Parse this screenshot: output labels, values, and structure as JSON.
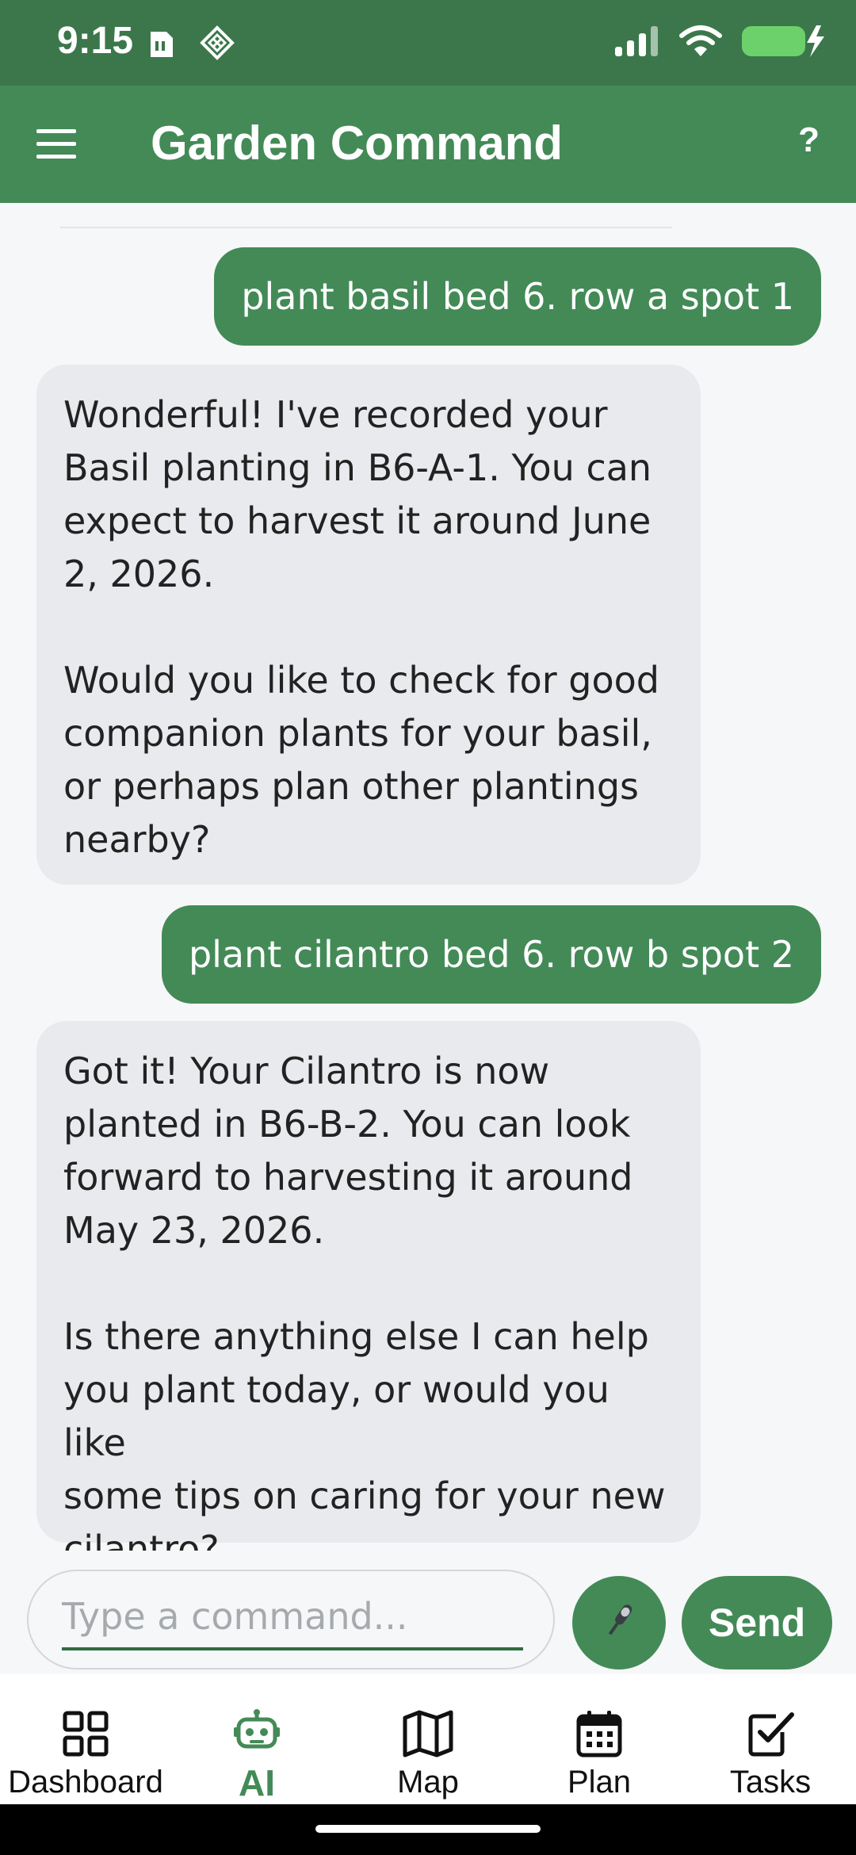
{
  "status_bar": {
    "time": "9:15",
    "left_icons": [
      "sim-card-icon",
      "diamond-icon"
    ],
    "right_icons": [
      "signal-icon",
      "wifi-icon",
      "battery-charging-icon"
    ],
    "battery_level": 0.95
  },
  "app_bar": {
    "menu_icon": "hamburger-menu-icon",
    "title": "Garden Command",
    "help_label": "?"
  },
  "chat": {
    "messages": [
      {
        "role": "user",
        "text": "plant basil bed 6. row a spot 1"
      },
      {
        "role": "assistant",
        "text": "Wonderful! I've recorded your\nBasil planting in B6-A-1. You can\nexpect to harvest it around June\n2, 2026.\n\nWould you like to check for good\ncompanion plants for your basil,\nor perhaps plan other plantings\nnearby?"
      },
      {
        "role": "user",
        "text": "plant cilantro bed 6. row b spot 2"
      },
      {
        "role": "assistant",
        "text": "Got it! Your Cilantro is now\nplanted in B6-B-2. You can look\nforward to harvesting it around\nMay 23, 2026.\n\nIs there anything else I can help\nyou plant today, or would you like\nsome tips on caring for your new\ncilantro?"
      }
    ]
  },
  "input": {
    "placeholder": "Type a command...",
    "value": "",
    "mic_icon": "microphone-icon",
    "send_label": "Send"
  },
  "bottom_nav": {
    "items": [
      {
        "label": "Dashboard",
        "icon": "dashboard-grid-icon",
        "active": false
      },
      {
        "label": "AI",
        "icon": "robot-icon",
        "active": true
      },
      {
        "label": "Map",
        "icon": "map-icon",
        "active": false
      },
      {
        "label": "Plan",
        "icon": "calendar-icon",
        "active": false
      },
      {
        "label": "Tasks",
        "icon": "checkbox-icon",
        "active": false
      }
    ]
  },
  "colors": {
    "status_bar": "#3b774b",
    "primary": "#438a57",
    "ai_bubble": "#e9eaed",
    "background": "#f6f7f9"
  }
}
